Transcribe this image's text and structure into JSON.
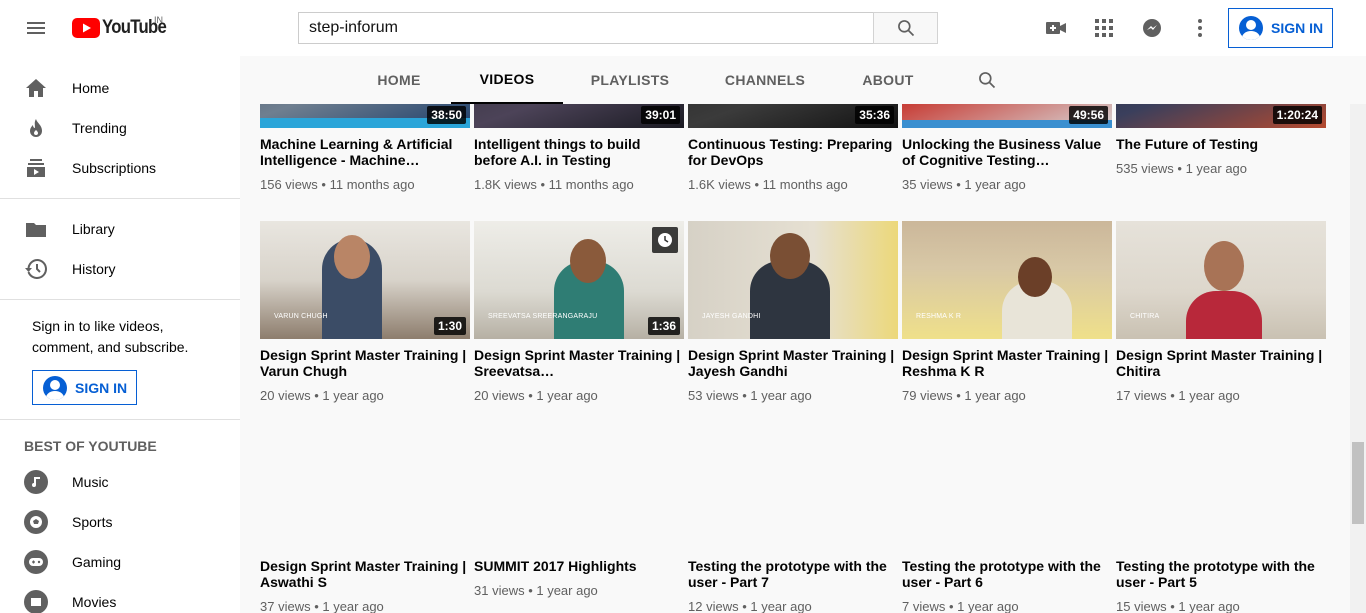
{
  "masthead": {
    "logo_text": "YouTube",
    "logo_region": "IN",
    "search_value": "step-inforum",
    "signin_label": "SIGN IN"
  },
  "sidebar": {
    "main": [
      {
        "label": "Home",
        "icon": "home-icon"
      },
      {
        "label": "Trending",
        "icon": "trending-icon"
      },
      {
        "label": "Subscriptions",
        "icon": "subscriptions-icon"
      }
    ],
    "library": [
      {
        "label": "Library",
        "icon": "library-icon"
      },
      {
        "label": "History",
        "icon": "history-icon"
      }
    ],
    "signin_prompt": "Sign in to like videos, comment, and subscribe.",
    "signin_label": "SIGN IN",
    "best_of_heading": "BEST OF YOUTUBE",
    "best_of": [
      {
        "label": "Music",
        "icon": "music-icon"
      },
      {
        "label": "Sports",
        "icon": "sports-icon"
      },
      {
        "label": "Gaming",
        "icon": "gaming-icon"
      },
      {
        "label": "Movies",
        "icon": "movies-icon"
      }
    ]
  },
  "tabs": [
    {
      "label": "HOME"
    },
    {
      "label": "VIDEOS"
    },
    {
      "label": "PLAYLISTS"
    },
    {
      "label": "CHANNELS"
    },
    {
      "label": "ABOUT"
    }
  ],
  "active_tab": "VIDEOS",
  "videos_row1": [
    {
      "title": "Machine Learning & Artificial Intelligence - Machine…",
      "meta": "156 views • 11 months ago",
      "duration": "38:50"
    },
    {
      "title": "Intelligent things to build before A.I. in Testing",
      "meta": "1.8K views • 11 months ago",
      "duration": "39:01"
    },
    {
      "title": "Continuous Testing: Preparing for DevOps",
      "meta": "1.6K views • 11 months ago",
      "duration": "35:36"
    },
    {
      "title": "Unlocking the Business Value of Cognitive Testing…",
      "meta": "35 views • 1 year ago",
      "duration": "49:56"
    },
    {
      "title": "The Future of Testing",
      "meta": "535 views • 1 year ago",
      "duration": "1:20:24"
    }
  ],
  "videos_row2": [
    {
      "title": "Design Sprint Master Training | Varun Chugh",
      "meta": "20 views • 1 year ago",
      "duration": "1:30",
      "name_tag": "VARUN CHUGH"
    },
    {
      "title": "Design Sprint Master Training | Sreevatsa…",
      "meta": "20 views • 1 year ago",
      "duration": "1:36",
      "name_tag": "SREEVATSA SREERANGARAJU"
    },
    {
      "title": "Design Sprint Master Training | Jayesh Gandhi",
      "meta": "53 views • 1 year ago",
      "duration": "",
      "name_tag": "JAYESH GANDHI"
    },
    {
      "title": "Design Sprint Master Training | Reshma K R",
      "meta": "79 views • 1 year ago",
      "duration": "",
      "name_tag": "RESHMA K R"
    },
    {
      "title": "Design Sprint Master Training | Chitira",
      "meta": "17 views • 1 year ago",
      "duration": "",
      "name_tag": "CHITIRA"
    }
  ],
  "videos_row3": [
    {
      "title": "Design Sprint Master Training | Aswathi S",
      "meta": "37 views • 1 year ago"
    },
    {
      "title": "SUMMIT 2017 Highlights",
      "meta": "31 views • 1 year ago"
    },
    {
      "title": "Testing the prototype with the user - Part 7",
      "meta": "12 views • 1 year ago"
    },
    {
      "title": "Testing the prototype with the user - Part 6",
      "meta": "7 views • 1 year ago"
    },
    {
      "title": "Testing the prototype with the user - Part 5",
      "meta": "15 views • 1 year ago"
    }
  ],
  "colors": {
    "accent": "#065fd4",
    "brand_red": "#ff0000",
    "text_secondary": "#606060"
  }
}
